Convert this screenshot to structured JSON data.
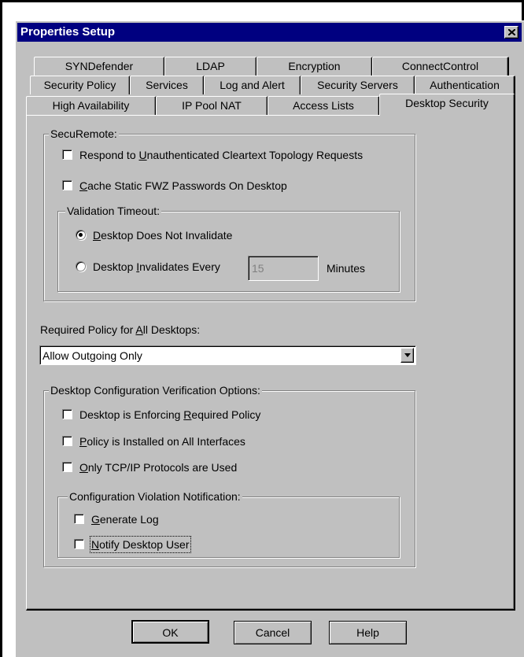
{
  "window": {
    "title": "Properties Setup",
    "close_icon": "close-icon"
  },
  "tabs": {
    "row1": [
      "SYNDefender",
      "LDAP",
      "Encryption",
      "ConnectControl"
    ],
    "row2": [
      "Security Policy",
      "Services",
      "Log and Alert",
      "Security Servers",
      "Authentication"
    ],
    "row3": [
      "High Availability",
      "IP Pool NAT",
      "Access Lists",
      "Desktop Security"
    ],
    "active": "Desktop Security"
  },
  "securemote": {
    "legend": "SecuRemote:",
    "respond_unauth": {
      "label_pre": "Respond to ",
      "label_u": "U",
      "label_post": "nauthenticated Cleartext Topology Requests",
      "checked": false
    },
    "cache_fwz": {
      "label_u": "C",
      "label_post": "ache Static FWZ Passwords On Desktop",
      "checked": false
    },
    "validation": {
      "legend": "Validation Timeout:",
      "no_invalidate": {
        "label_u": "D",
        "label_post": "esktop Does Not Invalidate",
        "selected": true
      },
      "invalidate_every": {
        "label_pre": "Desktop ",
        "label_u": "I",
        "label_post": "nvalidates Every",
        "selected": false
      },
      "timeout_value": "15",
      "minutes_label": "Minutes"
    }
  },
  "required_policy": {
    "label_pre": "Required Policy for ",
    "label_u": "A",
    "label_post": "ll Desktops:",
    "selected": "Allow Outgoing Only"
  },
  "verification": {
    "legend": "Desktop Configuration Verification Options:",
    "enforcing": {
      "label_pre": "Desktop is Enforcing ",
      "label_u": "R",
      "label_post": "equired Policy",
      "checked": false
    },
    "installed": {
      "label_u": "P",
      "label_post": "olicy is Installed on All Interfaces",
      "checked": false
    },
    "tcpip": {
      "label_u": "O",
      "label_post": "nly TCP/IP Protocols are Used",
      "checked": false
    },
    "notification": {
      "legend": "Configuration Violation Notification:",
      "generate_log": {
        "label_u": "G",
        "label_post": "enerate Log",
        "checked": false
      },
      "notify_user": {
        "label_u": "N",
        "label_post": "otify Desktop User",
        "checked": false
      }
    }
  },
  "buttons": {
    "ok": "OK",
    "cancel": "Cancel",
    "help": "Help"
  }
}
